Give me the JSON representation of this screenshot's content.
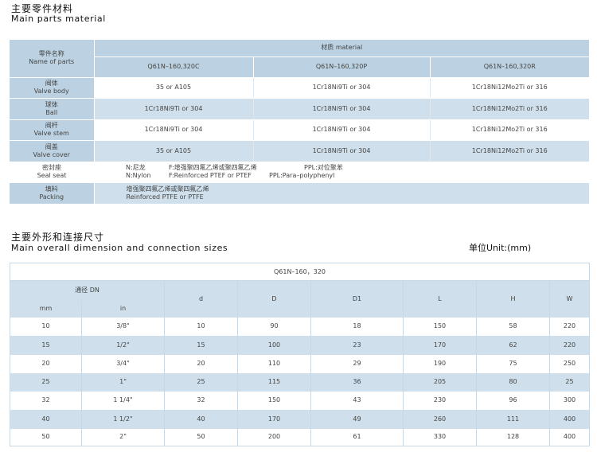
{
  "section1": {
    "title_cn": "主要零件材料",
    "title_en": "Main parts material"
  },
  "parts_table": {
    "parts_header_cn": "零件名称",
    "parts_header_en": "Name of parts",
    "material_header": "材质 material",
    "models": [
      "Q61N–160,320C",
      "Q61N–160,320P",
      "Q61N–160,320R"
    ],
    "rows": [
      {
        "cn": "阀体",
        "en": "Valve body",
        "values": [
          "35  or  A105",
          "1Cr18Ni9Ti  or 304",
          "1Cr18Ni12Mo2Ti  or 316"
        ]
      },
      {
        "cn": "球体",
        "en": "Ball",
        "values": [
          "1Cr18Ni9Ti  or 304",
          "1Cr18Ni9Ti  or 304",
          "1Cr18Ni12Mo2Ti  or 316"
        ]
      },
      {
        "cn": "阀杆",
        "en": "Valve stem",
        "values": [
          "1Cr18Ni9Ti  or 304",
          "1Cr18Ni9Ti  or 304",
          "1Cr18Ni12Mo2Ti  or 316"
        ]
      },
      {
        "cn": "阀盖",
        "en": "Valve cover",
        "values": [
          "35  or  A105",
          "1Cr18Ni9Ti  or 304",
          "1Cr18Ni12Mo2Ti  or 316"
        ]
      }
    ],
    "seal": {
      "cn": "密封座",
      "en": "Seal seat",
      "line1": [
        "N:尼龙",
        "F:增强聚四氟乙烯或聚四氟乙烯",
        "PPL:对位聚苯"
      ],
      "line2": [
        "N:Nylon",
        "F:Reinforced PTEF or PTEF",
        "PPL:Para–polyphenyl"
      ]
    },
    "packing": {
      "cn": "填料",
      "en": "Packing",
      "line1": "增强聚四氟乙烯或聚四氟乙烯",
      "line2": "Reinforced PTFE or PTFE"
    }
  },
  "section2": {
    "title_cn": "主要外形和连接尺寸",
    "title_en": "Main overall dimension and connection sizes",
    "unit": "单位Unit:(mm)"
  },
  "dim_table": {
    "model": "Q61N–160，320",
    "dn_header": "通径 DN",
    "dn_sub": [
      "mm",
      "in"
    ],
    "columns": [
      "d",
      "D",
      "D1",
      "L",
      "H",
      "W"
    ],
    "rows": [
      [
        "10",
        "3/8\"",
        "10",
        "90",
        "18",
        "150",
        "58",
        "220"
      ],
      [
        "15",
        "1/2\"",
        "15",
        "100",
        "23",
        "170",
        "62",
        "220"
      ],
      [
        "20",
        "3/4\"",
        "20",
        "110",
        "29",
        "190",
        "75",
        "250"
      ],
      [
        "25",
        "1\"",
        "25",
        "115",
        "36",
        "205",
        "80",
        "25"
      ],
      [
        "32",
        "1 1/4\"",
        "32",
        "150",
        "43",
        "230",
        "96",
        "300"
      ],
      [
        "40",
        "1 1/2\"",
        "40",
        "170",
        "49",
        "260",
        "111",
        "400"
      ],
      [
        "50",
        "2\"",
        "50",
        "200",
        "61",
        "330",
        "128",
        "400"
      ]
    ]
  }
}
